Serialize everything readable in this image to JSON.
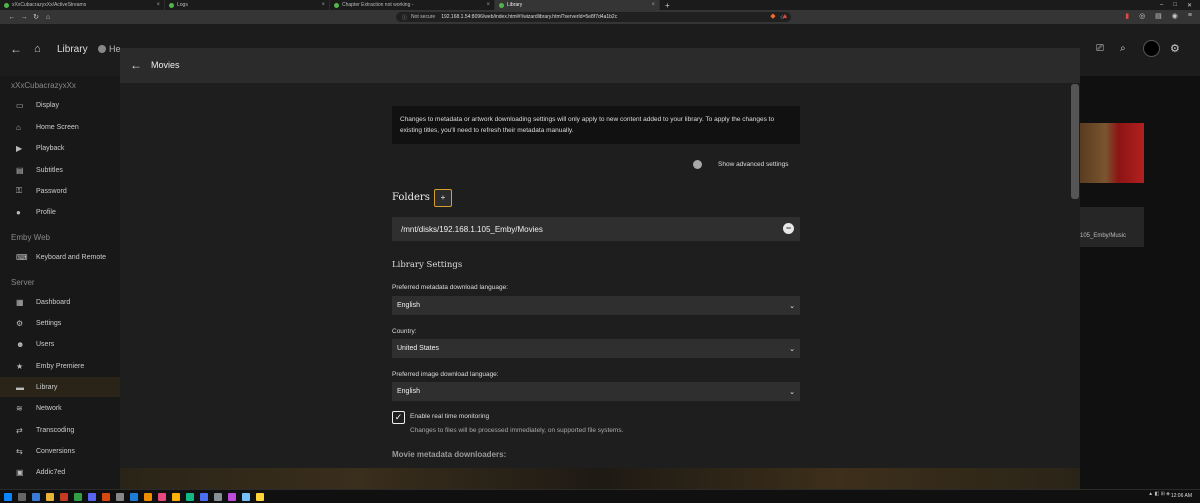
{
  "browser": {
    "tabs": [
      {
        "label": "xXxCubacrazyxXx/ActiveStreams"
      },
      {
        "label": "Logs"
      },
      {
        "label": "Chapter Extraction not working - "
      },
      {
        "label": "Library",
        "active": true
      }
    ],
    "address": {
      "security": "Not secure",
      "url": "192.168.1.54:8096/web/index.html#!/wizardlibrary.html?serverId=5e8f7d4a1b2c"
    }
  },
  "app": {
    "title": "Library",
    "header_fragment": "He"
  },
  "sidebar": {
    "user": "xXxCubacrazyxXx",
    "items": [
      {
        "icon": "display-icon",
        "glyph": "▭",
        "label": "Display"
      },
      {
        "icon": "home-icon",
        "glyph": "⌂",
        "label": "Home Screen"
      },
      {
        "icon": "play-icon",
        "glyph": "▶",
        "label": "Playback"
      },
      {
        "icon": "subtitles-icon",
        "glyph": "▤",
        "label": "Subtitles"
      },
      {
        "icon": "lock-icon",
        "glyph": "⚿",
        "label": "Password"
      },
      {
        "icon": "person-icon",
        "glyph": "●",
        "label": "Profile"
      }
    ],
    "section_web": "Emby Web",
    "web_items": [
      {
        "icon": "keyboard-icon",
        "glyph": "⌨",
        "label": "Keyboard and Remote"
      }
    ],
    "section_server": "Server",
    "server_items": [
      {
        "icon": "dashboard-icon",
        "glyph": "▦",
        "label": "Dashboard"
      },
      {
        "icon": "settings-icon",
        "glyph": "⚙",
        "label": "Settings"
      },
      {
        "icon": "users-icon",
        "glyph": "☻",
        "label": "Users"
      },
      {
        "icon": "star-icon",
        "glyph": "★",
        "label": "Emby Premiere"
      },
      {
        "icon": "folder-icon",
        "glyph": "▬",
        "label": "Library",
        "active": true
      },
      {
        "icon": "wifi-icon",
        "glyph": "≋",
        "label": "Network"
      },
      {
        "icon": "transcode-icon",
        "glyph": "⇄",
        "label": "Transcoding"
      },
      {
        "icon": "convert-icon",
        "glyph": "⇆",
        "label": "Conversions"
      },
      {
        "icon": "plugin-icon",
        "glyph": "▣",
        "label": "Addic7ed"
      }
    ]
  },
  "background": {
    "music_path_fragment": "105_Emby/Music"
  },
  "dialog": {
    "title": "Movies",
    "notice": "Changes to metadata or artwork downloading settings will only apply to new content added to your library. To apply the changes to existing titles, you'll need to refresh their metadata manually.",
    "advanced_toggle_label": "Show advanced settings",
    "folders_heading": "Folders",
    "add_folder_glyph": "+",
    "folders": [
      {
        "path": "/mnt/disks/192.168.1.105_Emby/Movies"
      }
    ],
    "library_settings_heading": "Library Settings",
    "fields": [
      {
        "label": "Preferred metadata download language:",
        "value": "English"
      },
      {
        "label": "Country:",
        "value": "United States"
      },
      {
        "label": "Preferred image download language:",
        "value": "English"
      }
    ],
    "realtime": {
      "checked": true,
      "label": "Enable real time monitoring",
      "help": "Changes to files will be processed immediately, on supported file systems."
    },
    "metadata_downloaders_heading": "Movie metadata downloaders:"
  },
  "taskbar": {
    "time": "12:06 AM"
  }
}
